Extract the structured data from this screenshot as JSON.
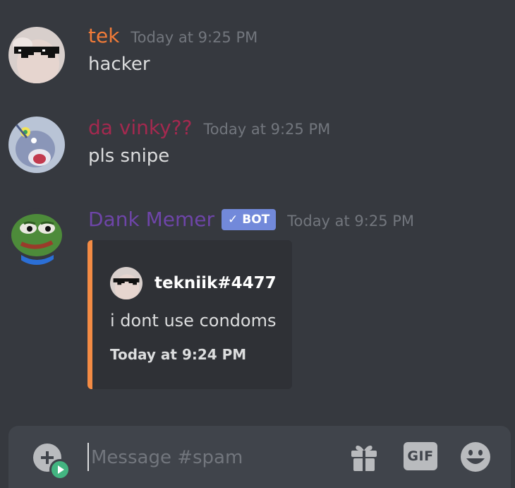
{
  "messages": [
    {
      "username": "tek",
      "username_color": "#f27b38",
      "timestamp": "Today at 9:25 PM",
      "text": "hacker"
    },
    {
      "username": "da vinky??",
      "username_color": "#a3294f",
      "timestamp": "Today at 9:25 PM",
      "text": "pls snipe"
    },
    {
      "username": "Dank Memer",
      "username_color": "#6e45a8",
      "badge": "BOT",
      "badge_check": "✓",
      "timestamp": "Today at 9:25 PM",
      "embed": {
        "author": "tekniik#4477",
        "description": "i dont use condoms",
        "footer": "Today at 9:24 PM",
        "accent": "#f48b44"
      }
    }
  ],
  "composer": {
    "placeholder": "Message #spam",
    "gif_label": "GIF",
    "icons": [
      "add-attachment-icon",
      "gift-icon",
      "gif-icon",
      "emoji-icon"
    ]
  }
}
